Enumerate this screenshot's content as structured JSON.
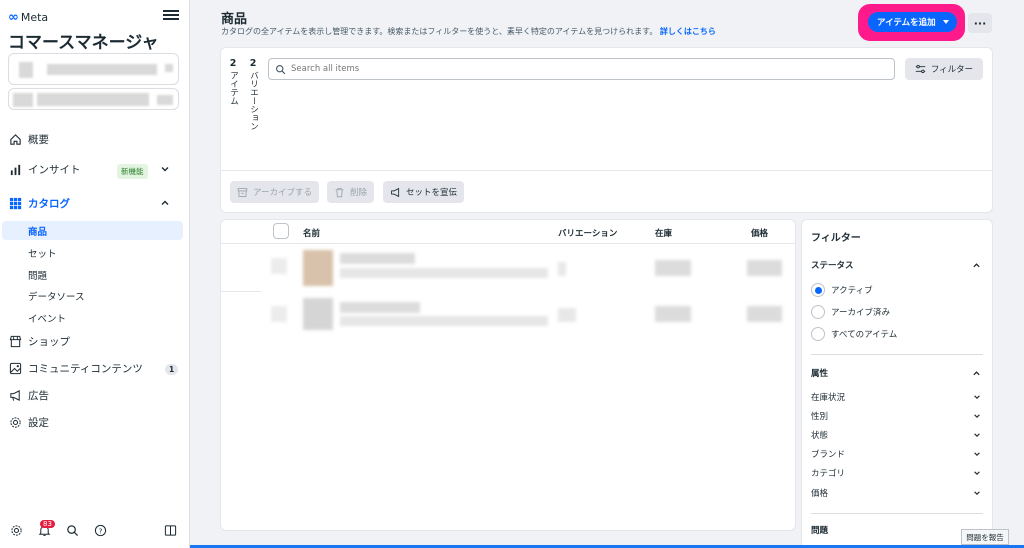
{
  "sidebar": {
    "brand": "Meta",
    "app_title": "コマースマネージャ",
    "nav": [
      {
        "label": "概要",
        "icon": "home-icon"
      },
      {
        "label": "インサイト",
        "icon": "insights-icon",
        "badge": "新機能"
      },
      {
        "label": "カタログ",
        "icon": "catalog-icon"
      },
      {
        "label": "ショップ",
        "icon": "shop-icon"
      },
      {
        "label": "コミュニティコンテンツ",
        "icon": "community-icon",
        "badge": "1"
      },
      {
        "label": "広告",
        "icon": "megaphone-icon"
      },
      {
        "label": "設定",
        "icon": "gear-icon"
      }
    ],
    "catalog_sub": [
      "商品",
      "セット",
      "問題",
      "データソース",
      "イベント"
    ],
    "notification_count": "83"
  },
  "header": {
    "title": "商品",
    "description": "カタログの全アイテムを表示し管理できます。検索またはフィルターを使うと、素早く特定のアイテムを見つけられます。",
    "learn_more": "詳しくはこちら",
    "add_item_label": "アイテムを追加",
    "more_label": "···"
  },
  "toolbar": {
    "item_count": "2",
    "item_count_label": "アイテム",
    "variation_count": "2",
    "variation_count_label": "バリエーション",
    "search_placeholder": "Search all items",
    "filter_label": "フィルター",
    "archive_label": "アーカイブする",
    "delete_label": "削除",
    "promote_label": "セットを宣伝"
  },
  "table": {
    "columns": [
      "名前",
      "バリエーション",
      "在庫",
      "価格"
    ]
  },
  "filters": {
    "title": "フィルター",
    "status_label": "ステータス",
    "status_options": [
      "アクティブ",
      "アーカイブ済み",
      "すべてのアイテム"
    ],
    "status_selected": "アクティブ",
    "attributes_label": "属性",
    "attributes": [
      "在庫状況",
      "性別",
      "状態",
      "ブランド",
      "カテゴリ",
      "価格"
    ],
    "issues_label": "問題"
  },
  "report_label": "問題を報告"
}
